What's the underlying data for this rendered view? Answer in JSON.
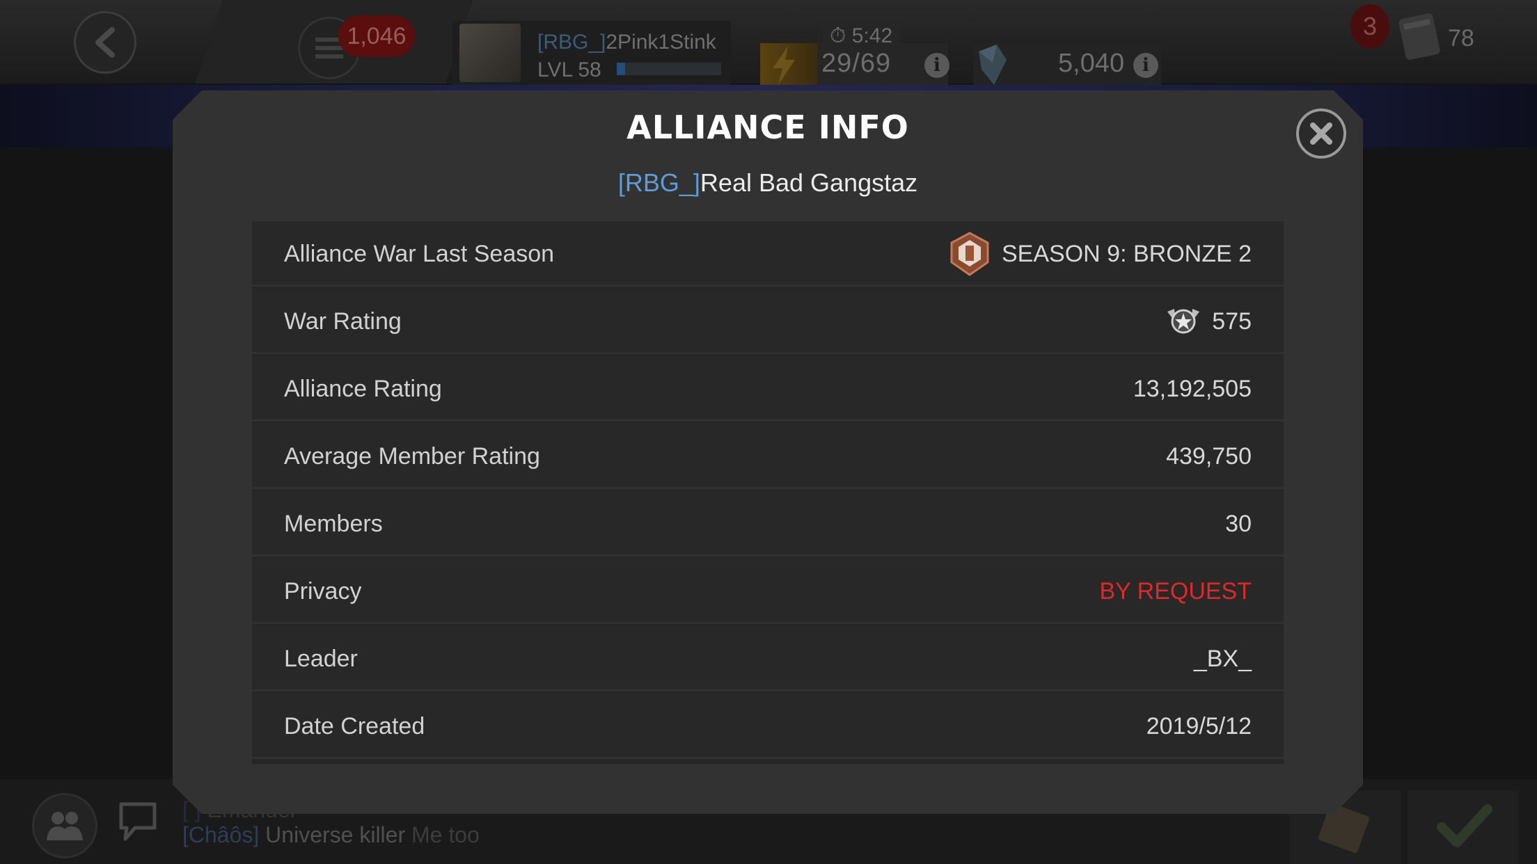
{
  "topbar": {
    "notification_count": "1,046",
    "player": {
      "tag": "[RBG_]",
      "name": "2Pink1Stink",
      "level": "LVL 58",
      "xp_progress": 0.08
    },
    "energy": {
      "timer": "5:42",
      "value": "29/69"
    },
    "crystals": {
      "value": "5,040"
    },
    "alerts_count": "3",
    "mail_count": "78",
    "icons": [
      "back-arrow-icon",
      "menu-icon",
      "energy-bolt-icon",
      "crystal-icon",
      "info-icon",
      "timer-icon",
      "mail-icon"
    ]
  },
  "dialog": {
    "title": "ALLIANCE INFO",
    "alliance_tag": "[RBG_]",
    "alliance_name": "Real Bad Gangstaz",
    "rows": [
      {
        "label": "Alliance War Last Season",
        "value": "SEASON 9: BRONZE 2",
        "icon": "bronze-badge-icon"
      },
      {
        "label": "War Rating",
        "value": "575",
        "icon": "war-rating-star-icon"
      },
      {
        "label": "Alliance Rating",
        "value": "13,192,505"
      },
      {
        "label": "Average Member Rating",
        "value": "439,750"
      },
      {
        "label": "Members",
        "value": "30"
      },
      {
        "label": "Privacy",
        "value": "BY REQUEST",
        "color": "#e02828"
      },
      {
        "label": "Leader",
        "value": "_BX_"
      },
      {
        "label": "Date Created",
        "value": "2019/5/12"
      }
    ]
  },
  "chat": {
    "line1": {
      "name": "[ ]",
      "user": "Emanuel",
      "msg": ""
    },
    "line2": {
      "name": "[Châôs]",
      "user": "Universe killer",
      "msg": "Me too"
    }
  },
  "colors": {
    "accent_blue": "#5f9bd6",
    "privacy_red": "#e02828",
    "dialog_bg": "#323232"
  }
}
